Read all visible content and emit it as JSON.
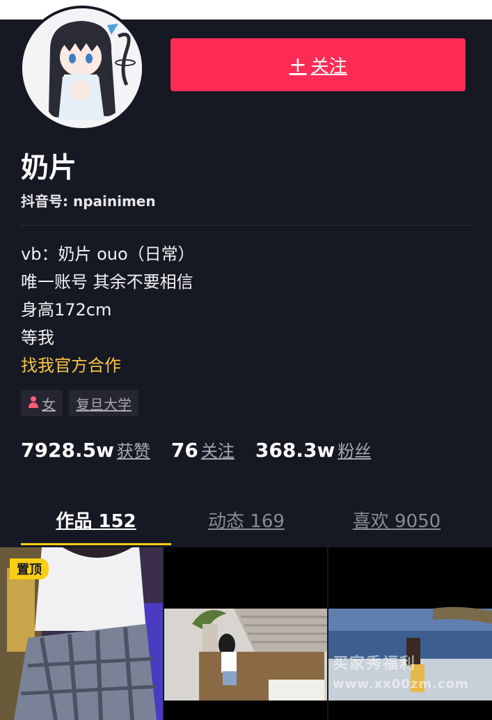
{
  "profile": {
    "follow_label": "关注",
    "name": "奶片",
    "douyin_id": "抖音号: npainimen",
    "bio": {
      "line1": "vb：奶片 ouo（日常）",
      "line2": "唯一账号 其余不要相信",
      "line3": "身高172cm",
      "line4": "等我",
      "line5": "找我官方合作"
    },
    "tags": {
      "gender": "女",
      "school": "复旦大学"
    },
    "stats": {
      "likes_value": "7928.5w",
      "likes_label": "获赞",
      "following_value": "76",
      "following_label": "关注",
      "fans_value": "368.3w",
      "fans_label": "粉丝"
    }
  },
  "tabs": {
    "works": "作品 152",
    "activity": "动态 169",
    "liked": "喜欢 9050"
  },
  "grid": {
    "pinned_label": "置顶"
  },
  "watermark": {
    "text": "买家秀福利",
    "url": "www.xx00zm.com"
  },
  "colors": {
    "background": "#161823",
    "accent": "#fe2c55",
    "tab_indicator": "#face15",
    "highlight_text": "#f7c344"
  }
}
